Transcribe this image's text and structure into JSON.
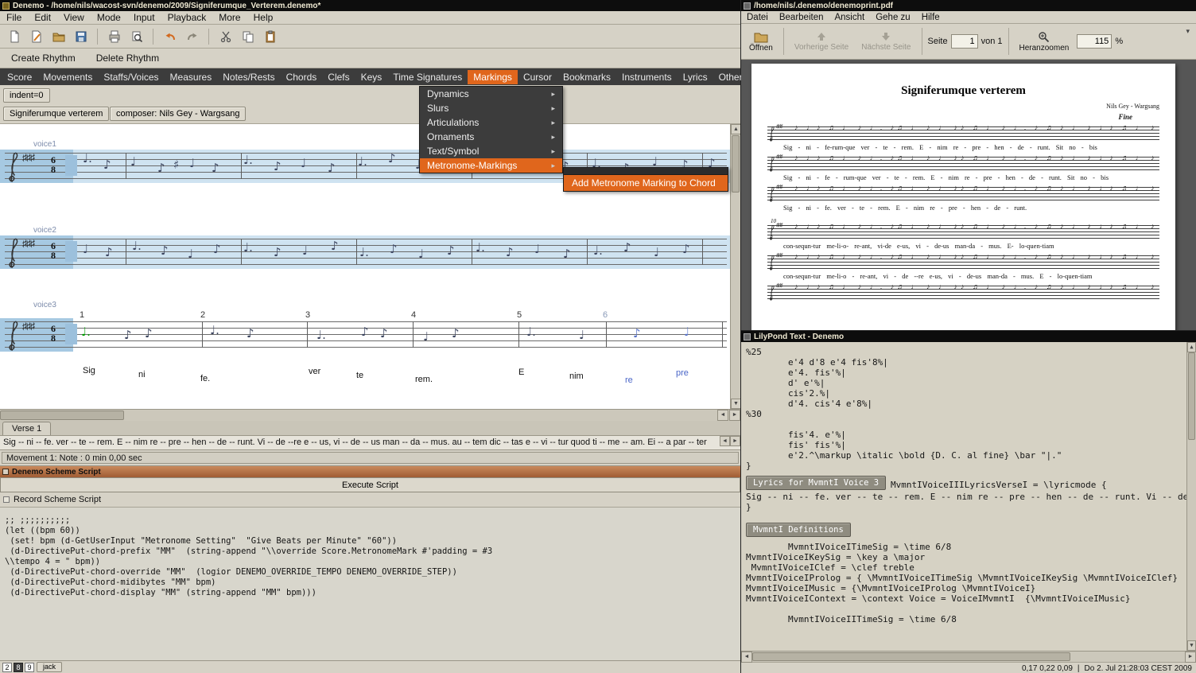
{
  "denemo": {
    "window_title": "Denemo  -  /home/nils/wacost-svn/denemo/2009/Signiferumque_Verterem.denemo*",
    "menubar": [
      "File",
      "Edit",
      "View",
      "Mode",
      "Input",
      "Playback",
      "More",
      "Help"
    ],
    "rhythm_toolbar": [
      "Create Rhythm",
      "Delete Rhythm"
    ],
    "command_bar": [
      {
        "label": "Score"
      },
      {
        "label": "Movements"
      },
      {
        "label": "Staffs/Voices"
      },
      {
        "label": "Measures"
      },
      {
        "label": "Notes/Rests"
      },
      {
        "label": "Chords"
      },
      {
        "label": "Clefs"
      },
      {
        "label": "Keys"
      },
      {
        "label": "Time Signatures"
      },
      {
        "label": "Markings",
        "cls": "active"
      },
      {
        "label": "Cursor"
      },
      {
        "label": "Bookmarks"
      },
      {
        "label": "Instruments"
      },
      {
        "label": "Lyrics"
      },
      {
        "label": "Other"
      }
    ],
    "markings_menu": [
      {
        "label": "Dynamics"
      },
      {
        "label": "Slurs"
      },
      {
        "label": "Articulations"
      },
      {
        "label": "Ornaments"
      },
      {
        "label": "Text/Symbol"
      },
      {
        "label": "Metronome-Markings",
        "cls": "active"
      }
    ],
    "submenu_item": "Add Metronome Marking to Chord",
    "indent_button": "indent=0",
    "title_button": "Signiferumque verterem",
    "composer_button": "composer: Nils Gey - Wargsang",
    "voice_labels": [
      "voice1",
      "voice2",
      "voice3"
    ],
    "key_signature": "♯♯♯",
    "time_sig_top": "6",
    "time_sig_bottom": "8",
    "measure_numbers": [
      {
        "label": "1"
      },
      {
        "label": "2"
      },
      {
        "label": "3"
      },
      {
        "label": "4"
      },
      {
        "label": "5"
      },
      {
        "label": "6",
        "cls": "dim"
      }
    ],
    "inline_lyrics": [
      {
        "label": "Sig"
      },
      {
        "label": "ni"
      },
      {
        "label": "fe."
      },
      {
        "label": "ver"
      },
      {
        "label": "te"
      },
      {
        "label": "rem."
      },
      {
        "label": "E"
      },
      {
        "label": "nim"
      },
      {
        "label": "re",
        "cls": "blue"
      },
      {
        "label": "pre",
        "cls": "blue"
      }
    ],
    "verse_tab": "Verse 1",
    "verse_text": "Sig -- ni -- fe. ver -- te -- rem. E -- nim re -- pre -- hen -- de -- runt. Vi -- de --re e -- us, vi -- de -- us man -- da -- mus.  au -- tem dic -- tas e -- vi -- tur quod ti -- me -- am. Ei -- a par -- ter",
    "status_text": "Movement 1: Note : 0 min 0,00 sec",
    "scheme": {
      "panel_title": "Denemo Scheme Script",
      "execute_button": "Execute Script",
      "record_label": "Record Scheme Script",
      "script_lines": [
        ";; ;;;;;;;;;;",
        "(let ((bpm 60))",
        " (set! bpm (d-GetUserInput \"Metronome Setting\"  \"Give Beats per Minute\" \"60\"))",
        " (d-DirectivePut-chord-prefix \"MM\"  (string-append \"\\\\override Score.MetronomeMark #'padding = #3",
        "\\\\tempo 4 = \" bpm))",
        " (d-DirectivePut-chord-override \"MM\"  (logior DENEMO_OVERRIDE_TEMPO DENEMO_OVERRIDE_STEP))",
        " (d-DirectivePut-chord-midibytes \"MM\" bpm)",
        " (d-DirectivePut-chord-display \"MM\" (string-append \"MM\" bpm)))"
      ]
    },
    "bottom_boxes": [
      {
        "label": "2"
      },
      {
        "label": "8",
        "cls": "dark"
      },
      {
        "label": "9"
      }
    ],
    "jack_button": "jack"
  },
  "pdf": {
    "window_title": "/home/nils/.denemo/denemoprint.pdf",
    "menubar": [
      "Datei",
      "Bearbeiten",
      "Ansicht",
      "Gehe zu",
      "Hilfe"
    ],
    "toolbar": {
      "open": "Öffnen",
      "prev": "Vorherige Seite",
      "next": "Nächste Seite",
      "page_label": "Seite",
      "page_value": "1",
      "page_of": "von 1",
      "zoom_label": "Heranzoomen",
      "zoom_value": "115",
      "percent": "%"
    },
    "page": {
      "title": "Signiferumque verterem",
      "composer": "Nils Gey - Wargsang",
      "fine": "Fine",
      "measure_10": "10",
      "lyric_lines": [
        "Sig - ni - fe-rum-que ver - te - rem.   E - nim   re - pre - hen - de - runt.   Sit   no - bis",
        "Sig - ni - fe - rum-que ver - te - rem.   E - nim   re - pre - hen - de - runt.   Sit   no - bis",
        "Sig - ni - fe.    ver - te - rem.   E - nim   re - pre - hen - de - runt.",
        "con-sequn-tur me-li-o- re-ant,   vi-de e-us,  vi - de-us man-da -  mus.   E- lo-quen-tiam",
        "con-sequn-tur me-li-o - re-ant, vi - de --re e-us,  vi - de-us man-da -  mus.   E - lo-quen-tiam"
      ]
    }
  },
  "lilypond": {
    "window_title": "LilyPond Text - Denemo",
    "code_top": [
      "%25",
      "        e'4 d'8 e'4 fis'8%|",
      "        e'4. fis'%|",
      "        d' e'%|",
      "        cis'2.%|",
      "        d'4. cis'4 e'8%|",
      "%30",
      "",
      "        fis'4. e'%|",
      "        fis' fis'%|",
      "        e'2.^\\markup \\italic \\bold {D. C. al fine} \\bar \"|.\"",
      "}"
    ],
    "lyrics_button": "Lyrics for MvmntI Voice 3",
    "lyrics_header": "MvmntIVoiceIIILyricsVerseI = \\lyricmode {",
    "lyrics_body": "Sig -- ni -- fe. ver -- te -- rem. E -- nim re -- pre -- hen -- de -- runt. Vi -- de --",
    "lyrics_close": "}",
    "definitions_button": "MvmntI Definitions",
    "code_bottom": [
      "        MvmntIVoiceITimeSig = \\time 6/8",
      "MvmntIVoiceIKeySig = \\key a \\major",
      " MvmntIVoiceIClef = \\clef treble",
      "MvmntIVoiceIProlog = { \\MvmntIVoiceITimeSig \\MvmntIVoiceIKeySig \\MvmntIVoiceIClef}",
      "MvmntIVoiceIMusic = {\\MvmntIVoiceIProlog \\MvmntIVoiceI}",
      "MvmntIVoiceIContext = \\context Voice = VoiceIMvmntI  {\\MvmntIVoiceIMusic}",
      "",
      "        MvmntIVoiceIITimeSig = \\time 6/8"
    ]
  },
  "clock": {
    "load": "0,17 0,22 0,09",
    "separator": "|",
    "datetime": "Do 2. Jul 21:28:03 CEST 2009"
  }
}
